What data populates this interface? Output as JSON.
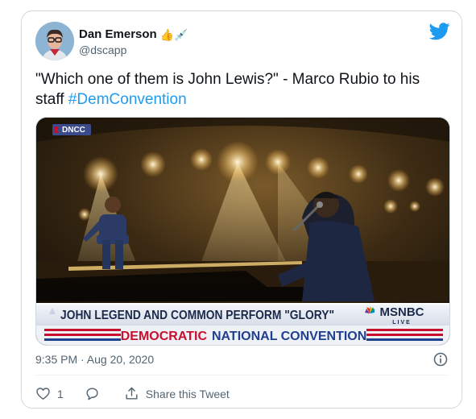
{
  "tweet": {
    "author": {
      "display_name": "Dan Emerson",
      "emoji": "👍💉",
      "handle": "@dscapp"
    },
    "text_before_hashtag": "\"Which one of them is John Lewis?\" - Marco Rubio to his staff ",
    "hashtag": "#DemConvention",
    "timestamp": "9:35 PM · Aug 20, 2020",
    "likes_count": "1",
    "share_label": "Share this Tweet"
  },
  "media": {
    "dncc_badge": "DNCC",
    "chyron_headline": "JOHN LEGEND AND COMMON PERFORM \"GLORY\"",
    "network": "MSNBC",
    "network_status": "LIVE",
    "banner_word_1": "DEMOCRATIC",
    "banner_word_2": "NATIONAL CONVENTION"
  },
  "colors": {
    "accent": "#1d9bf0",
    "chyron_text": "#1b2a4a",
    "banner_red": "#c8102e",
    "banner_blue": "#1f3f8f"
  },
  "icons": {
    "logo": "twitter-bird-icon",
    "info": "info-icon",
    "like": "heart-icon",
    "reply": "reply-bubble-icon",
    "share": "share-icon"
  }
}
